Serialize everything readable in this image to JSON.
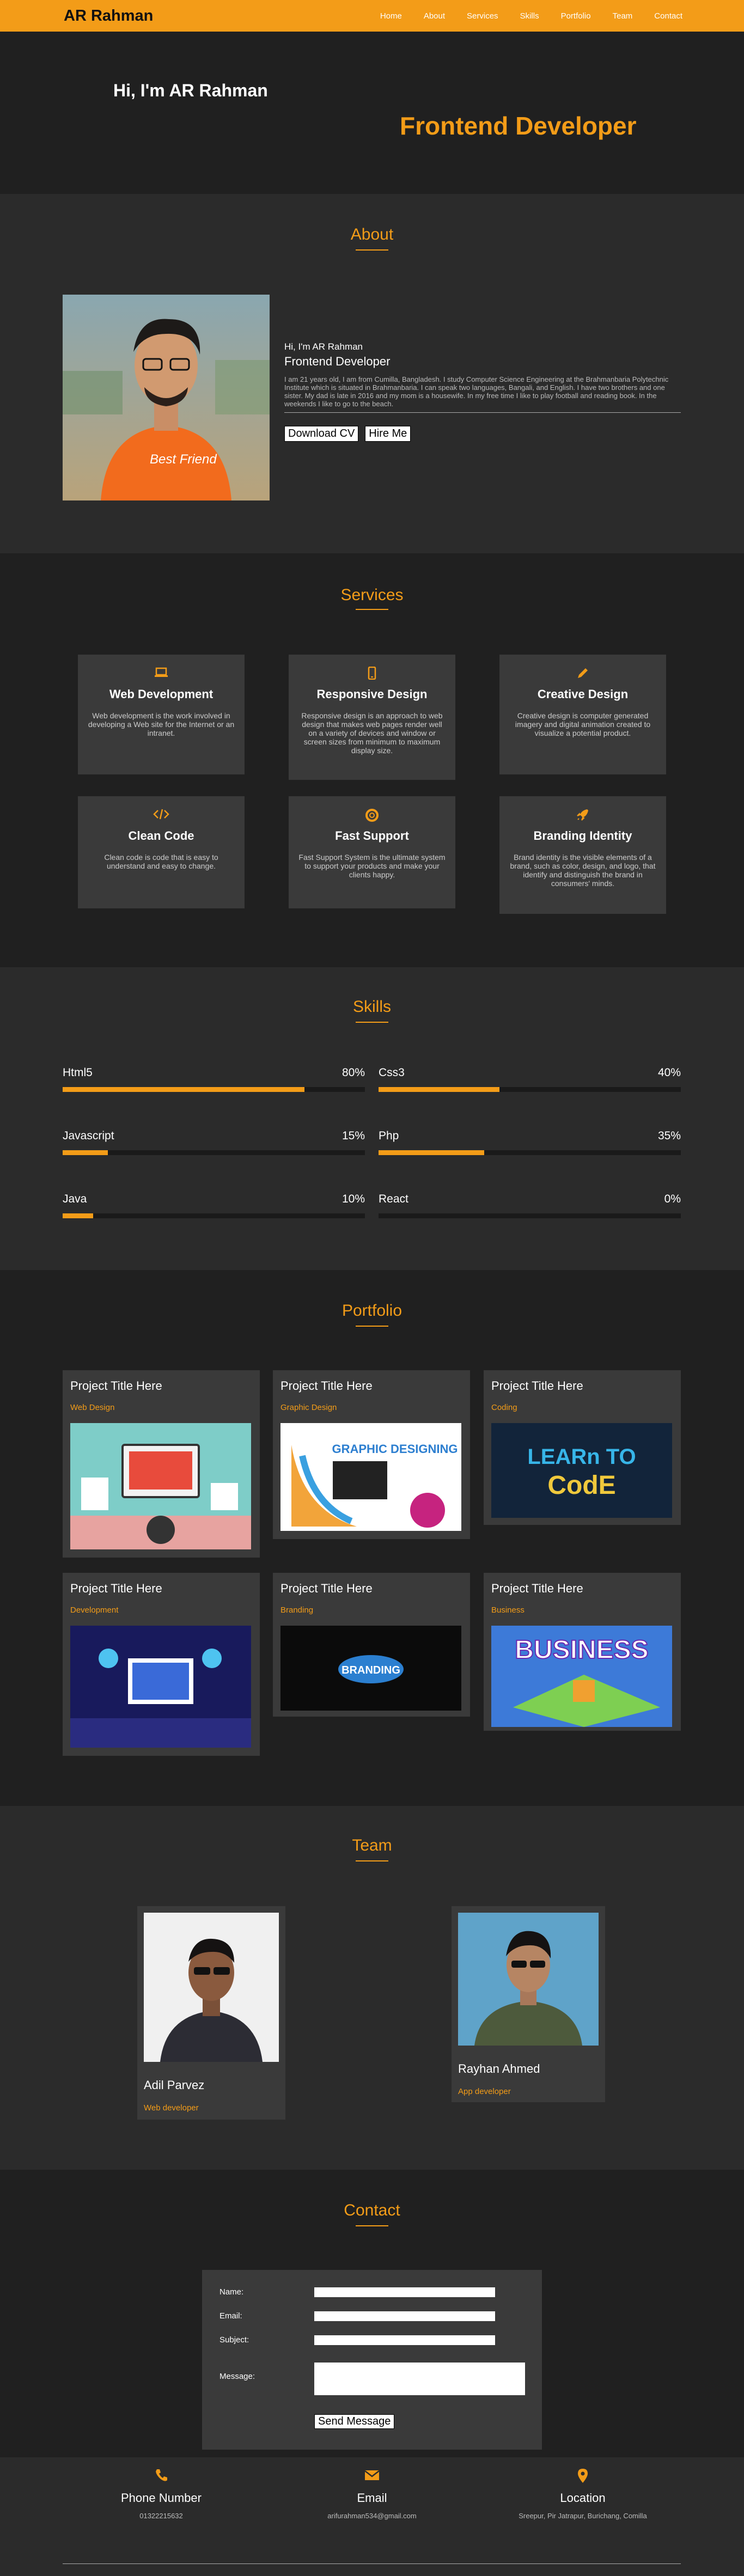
{
  "header": {
    "logo": "AR Rahman",
    "nav": [
      "Home",
      "About",
      "Services",
      "Skills",
      "Portfolio",
      "Team",
      "Contact"
    ]
  },
  "hero": {
    "greeting": "Hi, I'm AR Rahman",
    "role": "Frontend Developer"
  },
  "about": {
    "title": "About",
    "name_line": "Hi, I'm AR Rahman",
    "role": "Frontend Developer",
    "bio": "I am 21 years old, I am from Cumilla, Bangladesh. I study Computer Science Engineering at the Brahmanbaria Polytechnic Institute which is situated in Brahmanbaria. I can speak two languages, Bangali, and English. I have two brothers and one sister. My dad is late in 2016 and my mom is a housewife. In my free time I like to play football and reading book. In the weekends I like to go to the beach.",
    "download_btn": "Download CV",
    "hire_btn": "Hire Me"
  },
  "services": {
    "title": "Services",
    "items": [
      {
        "icon": "laptop-icon",
        "title": "Web Development",
        "desc": "Web development is the work involved in developing a Web site for the Internet or an intranet."
      },
      {
        "icon": "mobile-icon",
        "title": "Responsive Design",
        "desc": "Responsive design is an approach to web design that makes web pages render well on a variety of devices and window or screen sizes from minimum to maximum display size."
      },
      {
        "icon": "pencil-icon",
        "title": "Creative Design",
        "desc": "Creative design is computer generated imagery and digital animation created to visualize a potential product."
      },
      {
        "icon": "code-icon",
        "title": "Clean Code",
        "desc": "Clean code is code that is easy to understand and easy to change."
      },
      {
        "icon": "lifebuoy-icon",
        "title": "Fast Support",
        "desc": "Fast Support System is the ultimate system to support your products and make your clients happy."
      },
      {
        "icon": "rocket-icon",
        "title": "Branding Identity",
        "desc": "Brand identity is the visible elements of a brand, such as color, design, and logo, that identify and distinguish the brand in consumers' minds."
      }
    ]
  },
  "skills": {
    "title": "Skills",
    "items": [
      {
        "name": "Html5",
        "pct_label": "80%",
        "value": 0.8
      },
      {
        "name": "Css3",
        "pct_label": "40%",
        "value": 0.4
      },
      {
        "name": "Javascript",
        "pct_label": "15%",
        "value": 0.15
      },
      {
        "name": "Php",
        "pct_label": "35%",
        "value": 0.35
      },
      {
        "name": "Java",
        "pct_label": "10%",
        "value": 0.1
      },
      {
        "name": "React",
        "pct_label": "0%",
        "value": 0
      }
    ]
  },
  "portfolio": {
    "title": "Portfolio",
    "items": [
      {
        "title": "Project Title Here",
        "category": "Web Design"
      },
      {
        "title": "Project Title Here",
        "category": "Graphic Design",
        "img_text": "GRAPHIC DESIGNING"
      },
      {
        "title": "Project Title Here",
        "category": "Coding",
        "img_text": "LEARn TO CodE"
      },
      {
        "title": "Project Title Here",
        "category": "Development"
      },
      {
        "title": "Project Title Here",
        "category": "Branding",
        "img_text": "BRANDING"
      },
      {
        "title": "Project Title Here",
        "category": "Business",
        "img_text": "BUSINESS"
      }
    ]
  },
  "team": {
    "title": "Team",
    "members": [
      {
        "name": "Adil Parvez",
        "job": "Web developer"
      },
      {
        "name": "Rayhan Ahmed",
        "job": "App developer"
      }
    ]
  },
  "contact": {
    "title": "Contact",
    "name_label": "Name:",
    "email_label": "Email:",
    "subject_label": "Subject:",
    "message_label": "Message:",
    "send_btn": "Send Message"
  },
  "footer": {
    "items": [
      {
        "icon": "phone-icon",
        "title": "Phone Number",
        "value": "01322215632"
      },
      {
        "icon": "envelope-icon",
        "title": "Email",
        "value": "arifurahman534@gmail.com"
      },
      {
        "icon": "map-marker-icon",
        "title": "Location",
        "value": "Sreepur, Pir Jatrapur, Burichang, Comilla"
      }
    ]
  },
  "colors": {
    "accent": "#f39c18",
    "bg_dark": "#202020",
    "bg_mid": "#2b2b2b",
    "card": "#3a3a3a"
  }
}
